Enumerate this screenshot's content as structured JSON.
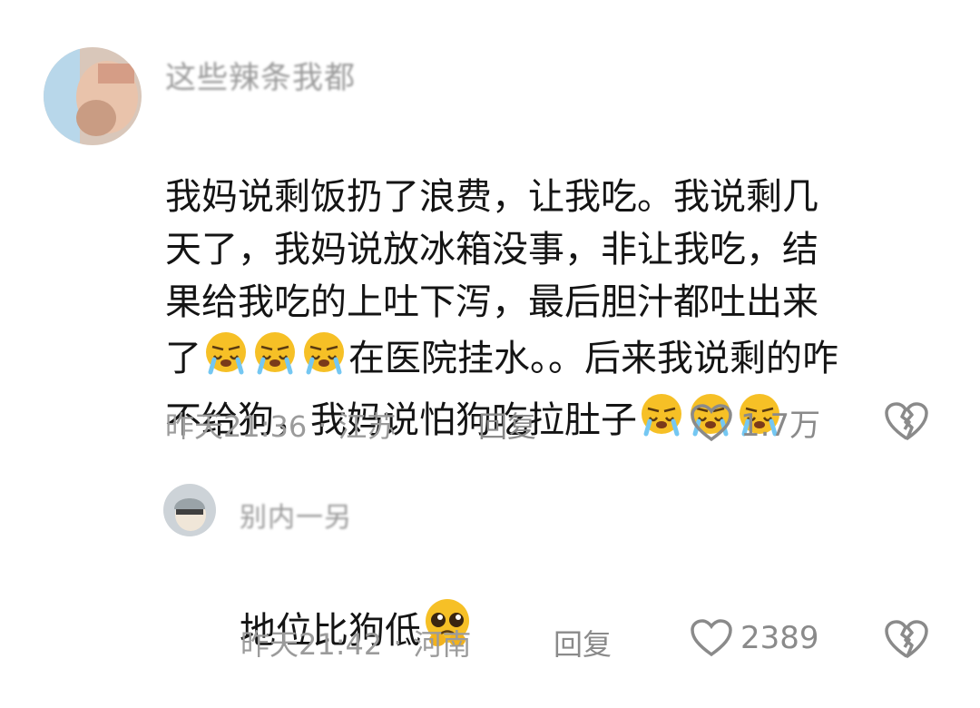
{
  "comments": [
    {
      "username": "这些辣条我都",
      "text": "我妈说剩饭扔了浪费，让我吃。我说剩几\n天了，我妈说放冰箱没事，非让我吃，结\n果给我吃的上吐下泻，最后胆汁都吐出来\n了",
      "text_mid": "在医院挂水。。后来我说剩的咋",
      "text_line5": "不给狗，我妈说怕狗吃拉肚子",
      "time": "昨天21:36",
      "location": "江苏",
      "reply_label": "回复",
      "like_count": "1.7万",
      "emoji": "crying-face"
    },
    {
      "username": "别内一另",
      "text": "地位比狗低",
      "time": "昨天21:42",
      "location": "河南",
      "reply_label": "回复",
      "like_count": "2389",
      "emoji": "pleading-face"
    }
  ],
  "colors": {
    "text": "#141414",
    "meta": "#9b9b9b",
    "emoji": "#f6c026"
  }
}
